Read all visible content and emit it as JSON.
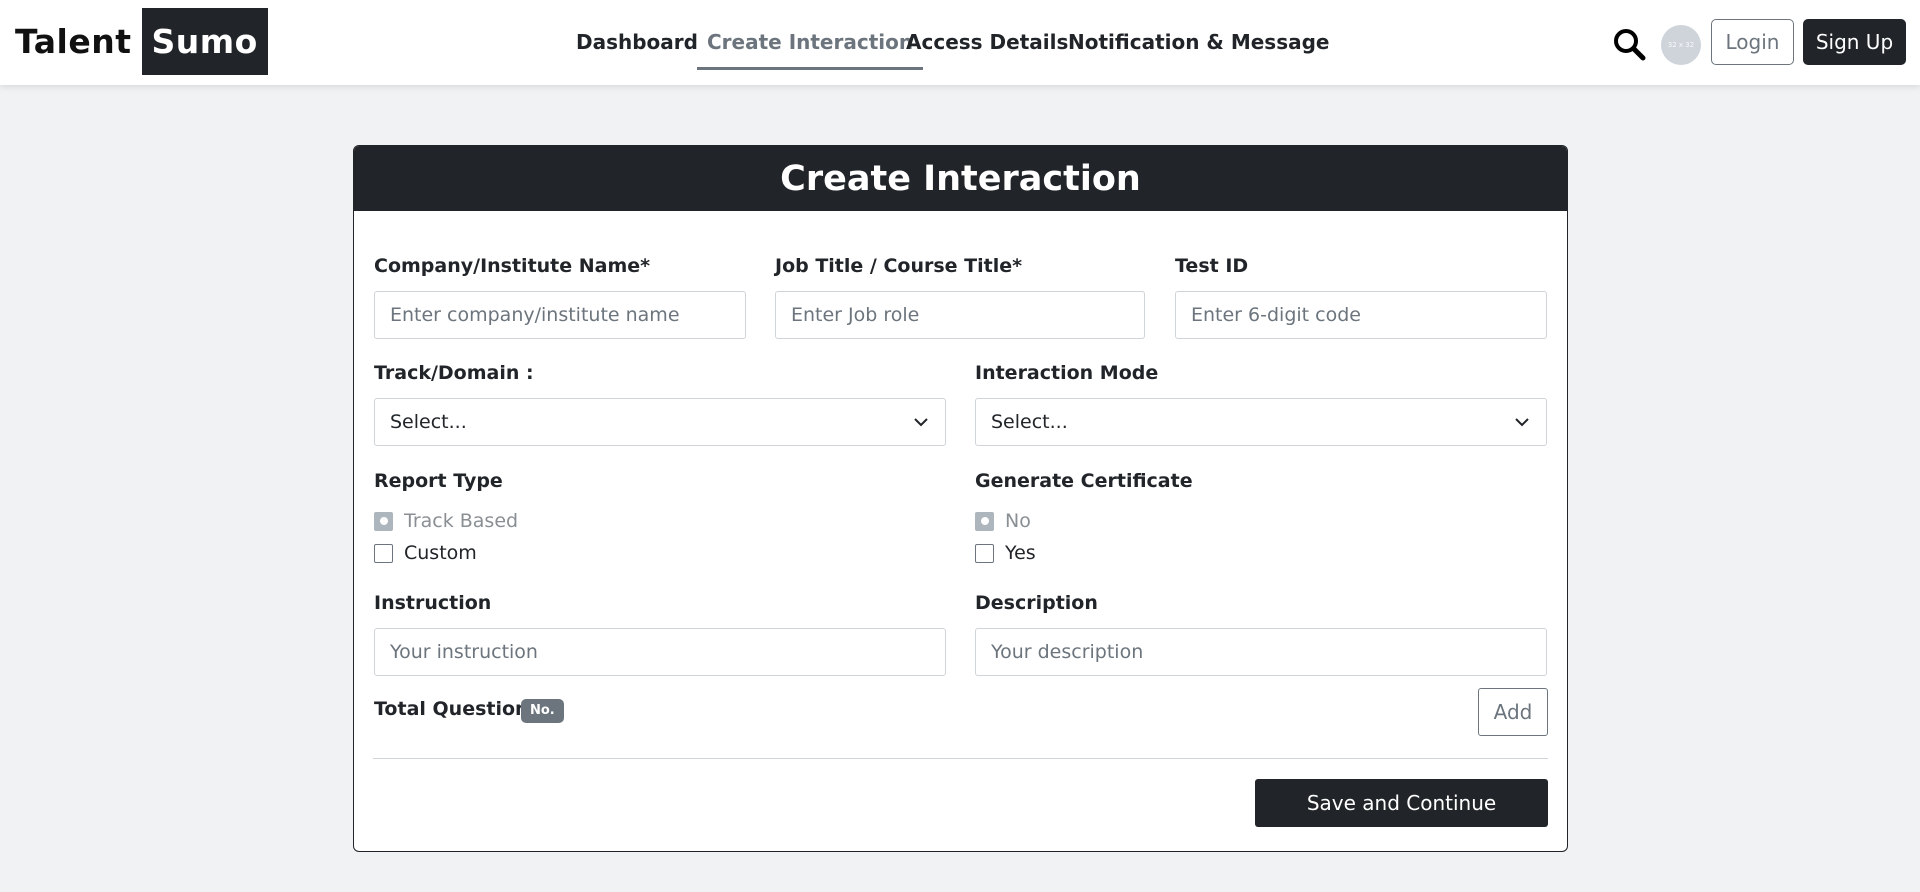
{
  "brand": {
    "part1": "Talent",
    "part2": "Sumo"
  },
  "nav": {
    "items": [
      "Dashboard",
      "Create Interaction",
      "Access Details",
      "Notification & Message"
    ],
    "active": "Create Interaction"
  },
  "header_actions": {
    "avatar_text": "32 x 32",
    "login": "Login",
    "signup": "Sign Up"
  },
  "form": {
    "title": "Create Interaction",
    "company": {
      "label": "Company/Institute Name*",
      "placeholder": "Enter company/institute name"
    },
    "job_title": {
      "label": "Job Title / Course Title*",
      "placeholder": "Enter Job role"
    },
    "test_id": {
      "label": "Test ID",
      "placeholder": "Enter 6-digit code"
    },
    "track": {
      "label": "Track/Domain :",
      "value": "Select..."
    },
    "interaction_mode": {
      "label": "Interaction Mode",
      "value": "Select..."
    },
    "report_type": {
      "label": "Report Type",
      "options": [
        "Track Based",
        "Custom"
      ],
      "selected": "Track Based"
    },
    "certificate": {
      "label": "Generate Certificate",
      "options": [
        "No",
        "Yes"
      ],
      "selected": "No"
    },
    "instruction": {
      "label": "Instruction",
      "placeholder": "Your instruction"
    },
    "description": {
      "label": "Description",
      "placeholder": "Your description"
    },
    "total_question": {
      "label": "Total Question:",
      "badge": "No."
    },
    "add_button": "Add",
    "save_button": "Save and Continue"
  },
  "icons": {
    "search": "search-icon",
    "chevron": "chevron-down-icon"
  }
}
